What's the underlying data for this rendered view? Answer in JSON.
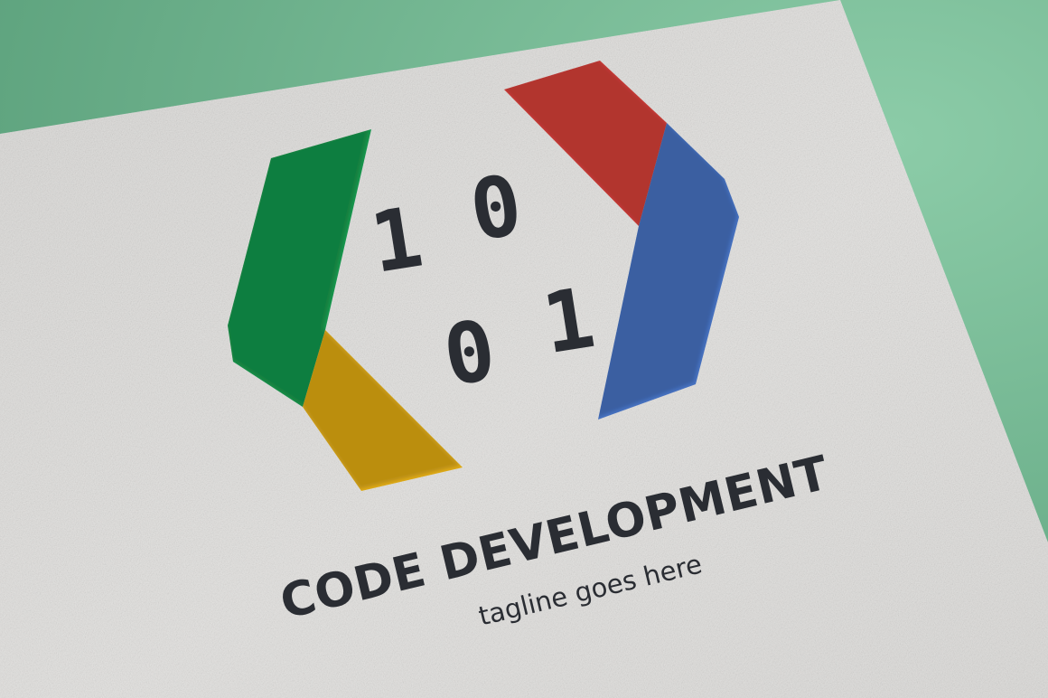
{
  "scene": {
    "background_color": "#6fb58f",
    "card_color": "#e4e3e1"
  },
  "logo": {
    "digits": [
      "1",
      "0",
      "0",
      "1"
    ],
    "colors": {
      "green": "#1f9a50",
      "yellow": "#e2ad1a",
      "red": "#d8423c",
      "blue": "#4a74c4"
    }
  },
  "brand": {
    "name": "CODE DEVELOPMENT",
    "tagline": "tagline goes here"
  }
}
